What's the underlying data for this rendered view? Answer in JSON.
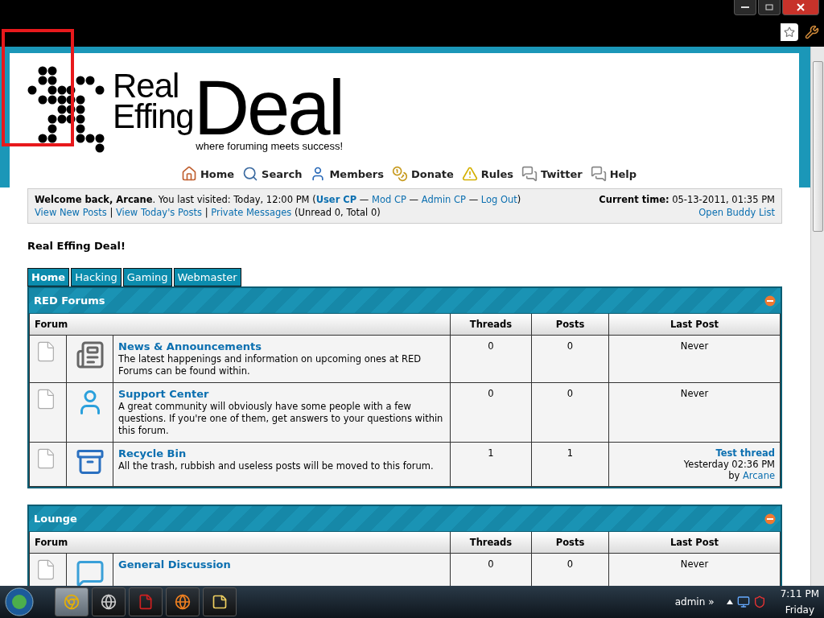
{
  "logo": {
    "line1": "Real",
    "line2": "Effing",
    "word": "Deal",
    "tagline": "where foruming meets success!"
  },
  "nav": [
    {
      "label": "Home"
    },
    {
      "label": "Search"
    },
    {
      "label": "Members"
    },
    {
      "label": "Donate"
    },
    {
      "label": "Rules"
    },
    {
      "label": "Twitter"
    },
    {
      "label": "Help"
    }
  ],
  "welcome": {
    "greeting": "**Welcome back, Arcane**. You last visited: Today, 12:00 PM",
    "open": "(",
    "cp_links": [
      {
        "label": "User CP",
        "bold": true
      },
      {
        "label": "Mod CP",
        "bold": false
      },
      {
        "label": "Admin CP",
        "bold": false
      },
      {
        "label": "Log Out",
        "bold": false
      }
    ],
    "separator": "—",
    "close": ")",
    "quick_links": [
      {
        "label": "View New Posts"
      },
      {
        "label": "View Today's Posts"
      },
      {
        "label": "Private Messages"
      }
    ],
    "link_separator": "|",
    "messages_count": "(Unread 0, Total 0)",
    "current_time": "**Current time:** 05-13-2011, 01:35 PM",
    "buddy_link": "Open Buddy List"
  },
  "page_title": "Real Effing Deal!",
  "tabs": [
    {
      "label": "Home",
      "selected": true
    },
    {
      "label": "Hacking",
      "selected": false
    },
    {
      "label": "Gaming",
      "selected": false
    },
    {
      "label": "Webmaster",
      "selected": false
    }
  ],
  "categories": [
    {
      "title": "RED Forums",
      "expanded": true,
      "columns": [
        "Forum",
        "Threads",
        "Posts",
        "Last Post"
      ],
      "forums": [
        {
          "name": "News & Announcements",
          "description": "The latest happenings and information on upcoming ones at RED Forums can be found within.",
          "threads": "0",
          "posts": "0",
          "last_post": {
            "kind": "never",
            "text": "Never"
          }
        },
        {
          "name": "Support Center",
          "description": "A great community will obviously have some people with a few questions. If you're one of them, get answers to your questions within this forum.",
          "threads": "0",
          "posts": "0",
          "last_post": {
            "kind": "never",
            "text": "Never"
          }
        },
        {
          "name": "Recycle Bin",
          "description": "All the trash, rubbish and useless posts will be moved to this forum.",
          "threads": "1",
          "posts": "1",
          "last_post": {
            "kind": "thread",
            "thread": "Test thread",
            "time": "Yesterday 02:36 PM",
            "by": "by",
            "author": "Arcane"
          }
        }
      ]
    },
    {
      "title": "Lounge",
      "expanded": true,
      "columns": [
        "Forum",
        "Threads",
        "Posts",
        "Last Post"
      ],
      "forums": [
        {
          "name": "General Discussion",
          "threads": "0",
          "posts": "0",
          "last_post": {
            "kind": "never",
            "text": "Never"
          }
        }
      ]
    }
  ],
  "taskbar": {
    "apps": [
      {
        "selected": true
      },
      {
        "selected": false
      },
      {
        "selected": false
      },
      {
        "selected": false
      },
      {
        "selected": false
      }
    ],
    "user": "admin",
    "chevron": "»",
    "time": "7:11 PM",
    "day": "Friday"
  }
}
